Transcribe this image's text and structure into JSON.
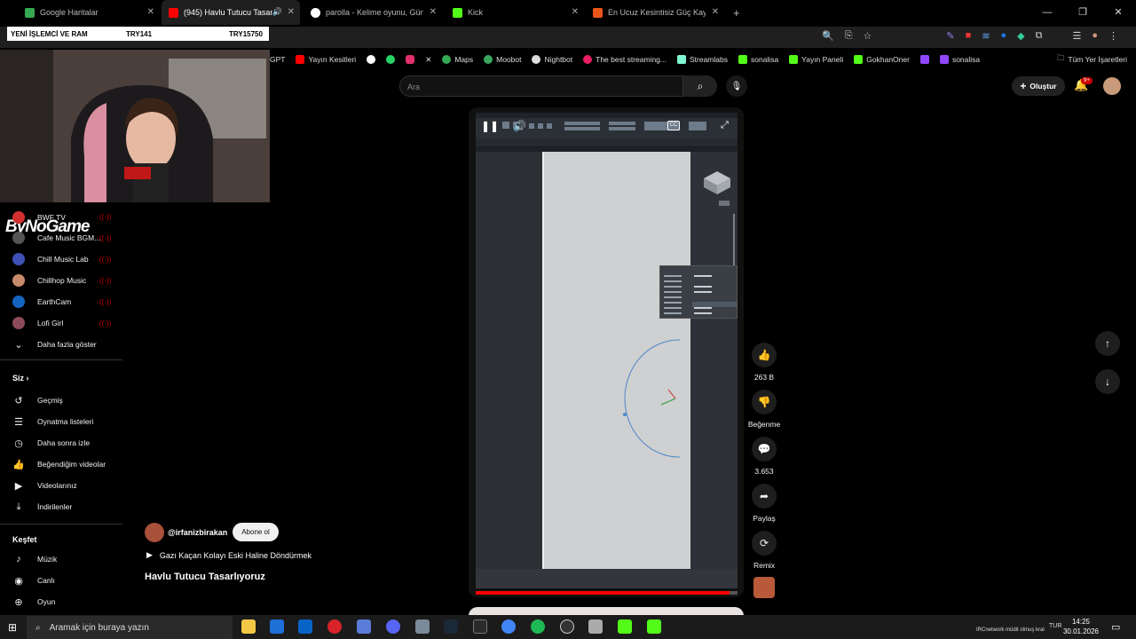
{
  "tabs": [
    {
      "title": "Google Haritalar",
      "color": "#34a853"
    },
    {
      "title": "(945) Havlu Tutucu Tasarlıy...",
      "color": "#ff0000"
    },
    {
      "title": "parolla - Kelime oyunu, Günlük...",
      "color": "#ffffff"
    },
    {
      "title": "Kick",
      "color": "#53fc18"
    },
    {
      "title": "En Ucuz Kesintisiz Güç Kaynak...",
      "color": "#e8561a"
    }
  ],
  "banner": {
    "text": "YENİ İŞLEMCİ VE RAM",
    "price1": "TRY141",
    "price2": "TRY15750"
  },
  "bookmarks": [
    {
      "label": "GPT",
      "color": "#888888"
    },
    {
      "label": "Yayın Kesitleri",
      "color": "#ff0000"
    },
    {
      "label": "",
      "color": "#ffffff"
    },
    {
      "label": "",
      "color": "#25d366"
    },
    {
      "label": "",
      "color": "#e1306c"
    },
    {
      "label": "",
      "color": "#ffffff"
    },
    {
      "label": "Maps",
      "color": "#34a853"
    },
    {
      "label": "Moobot",
      "color": "#3ba55d"
    },
    {
      "label": "Nightbot",
      "color": "#dddddd"
    },
    {
      "label": "The best streaming...",
      "color": "#e91e63"
    },
    {
      "label": "Streamlabs",
      "color": "#80f5d2"
    },
    {
      "label": "sonalisa",
      "color": "#53fc18"
    },
    {
      "label": "Yayın Paneli",
      "color": "#53fc18"
    },
    {
      "label": "GokhanOner",
      "color": "#53fc18"
    },
    {
      "label": "",
      "color": "#9146ff"
    },
    {
      "label": "sonalisa",
      "color": "#9146ff"
    }
  ],
  "bookmarks_all": "Tüm Yer İşaretleri",
  "logo": "ByNoGame",
  "subscriptions": [
    {
      "name": "BWF TV",
      "color": "#d32f2f"
    },
    {
      "name": "Cafe Music BGM...",
      "color": "#555555"
    },
    {
      "name": "Chill Music Lab",
      "color": "#3f51b5"
    },
    {
      "name": "Chillhop Music",
      "color": "#c58b6a"
    },
    {
      "name": "EarthCam",
      "color": "#1565c0"
    },
    {
      "name": "Lofi Girl",
      "color": "#8d4b5a"
    }
  ],
  "show_more": "Daha fazla göster",
  "you_section": {
    "title": "Siz",
    "items": [
      "Geçmiş",
      "Oynatma listeleri",
      "Daha sonra izle",
      "Beğendiğim videolar",
      "Videolarınız",
      "İndirilenler"
    ]
  },
  "explore_section": {
    "title": "Keşfet",
    "items": [
      "Müzik",
      "Canlı",
      "Oyun"
    ]
  },
  "search": {
    "placeholder": "Ara"
  },
  "create_label": "Oluştur",
  "notif_badge": "9+",
  "actions": {
    "likes": "263 B",
    "dislike": "Beğenme",
    "comments": "3.653",
    "share": "Paylaş",
    "remix": "Remix"
  },
  "channel": {
    "handle": "@irfanizbirakan",
    "subscribe": "Abone ol"
  },
  "music": "Gazı Kaçan Kolayı Eski Haline Döndürmek",
  "video_title": "Havlu Tutucu Tasarlıyoruz",
  "progress": 0.97,
  "taskbar": {
    "search_placeholder": "Aramak için buraya yazın",
    "time": "14:25",
    "date": "30.01.2026",
    "lang": "TUR",
    "ticker": "IRCnetwork müdit olmuş kral"
  }
}
